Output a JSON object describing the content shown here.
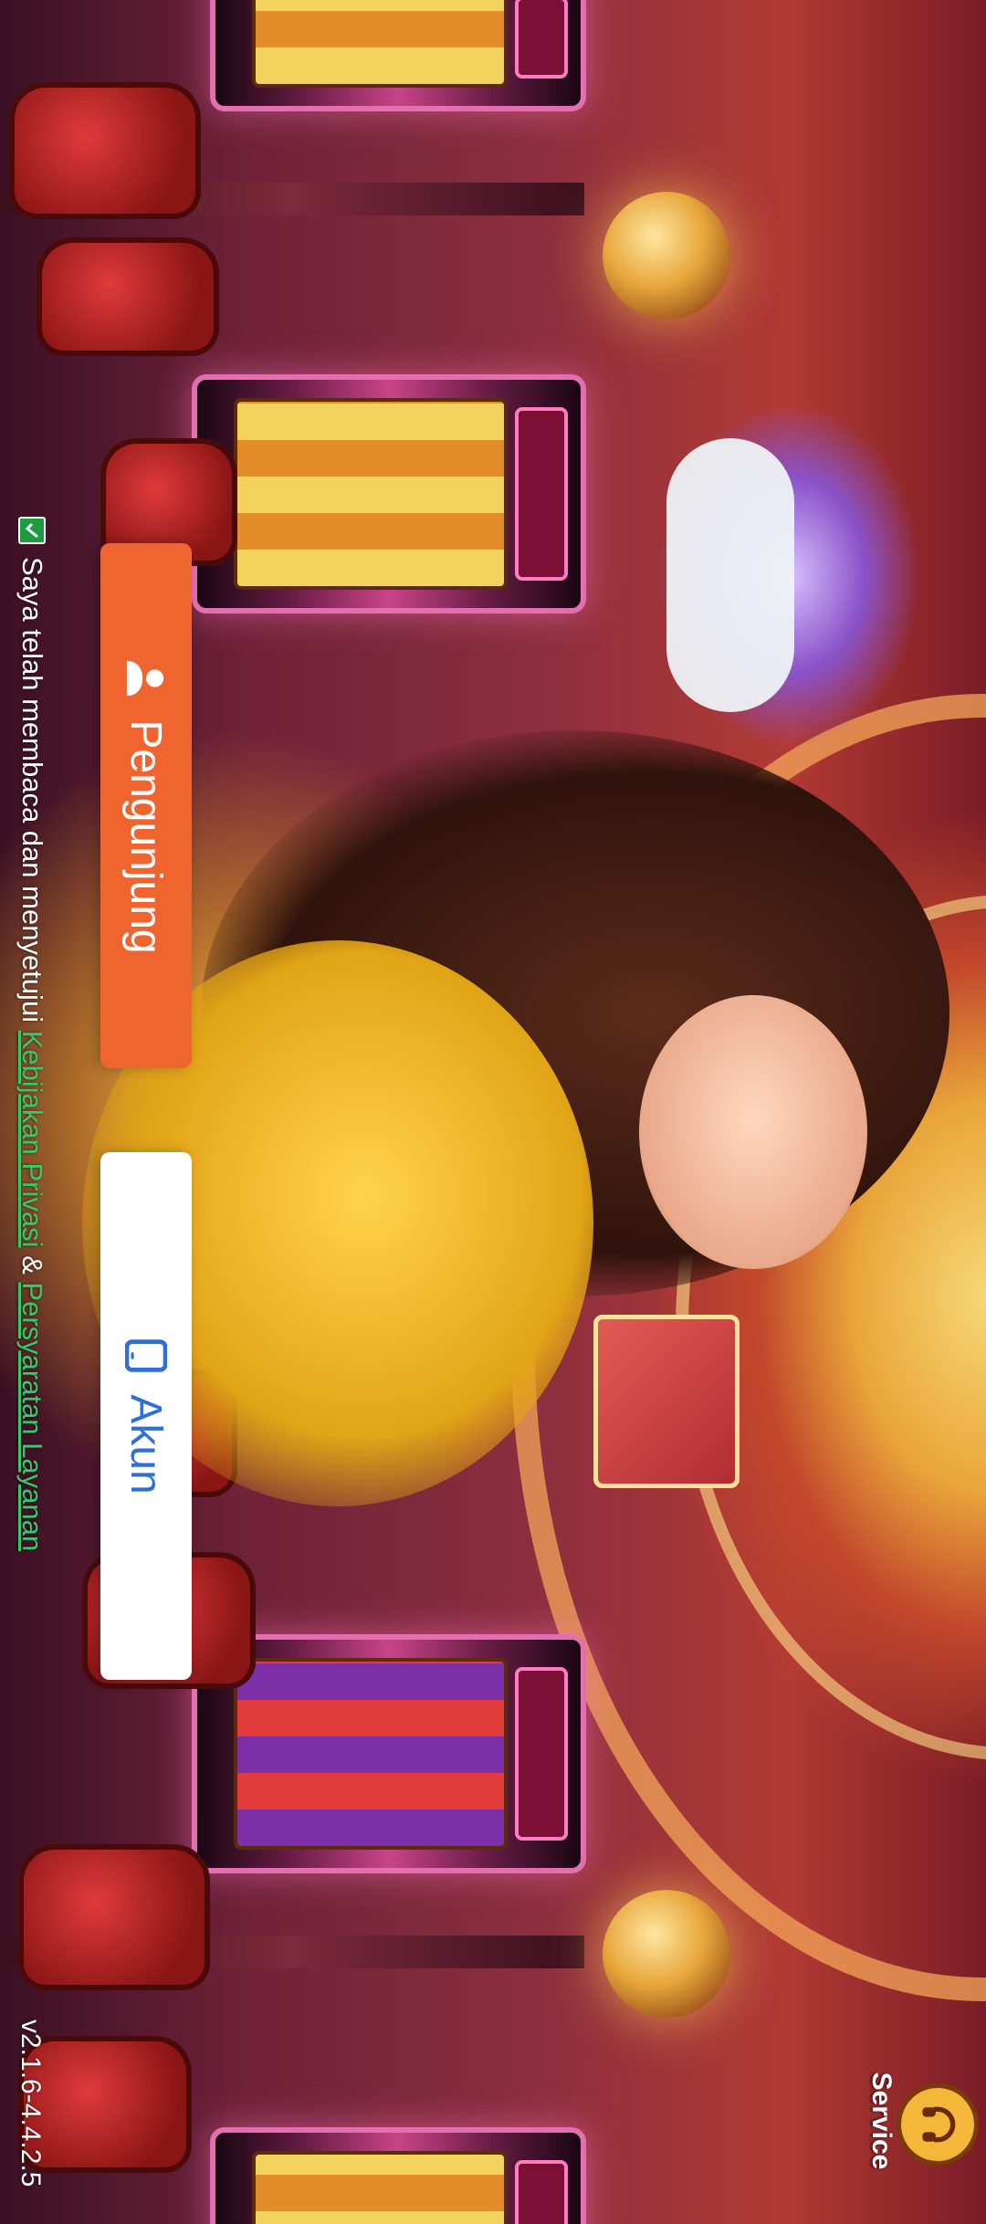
{
  "login": {
    "visitor_label": "Pengunjung",
    "account_label": "Akun",
    "agreement": {
      "checked": true,
      "text": "Saya telah membaca dan menyetujui ",
      "privacy_link": "Kebijakan Privasi",
      "separator": " & ",
      "terms_link": "Persyaratan Layanan"
    }
  },
  "service": {
    "label": "Service",
    "icon": "headset-icon"
  },
  "version": "v2.1.6-4.4.2.5",
  "colors": {
    "visitor_button": "#f0642f",
    "account_button": "#ffffff",
    "account_text": "#2f6fd6",
    "link": "#35c96b",
    "checkbox": "#1c9b3f"
  }
}
